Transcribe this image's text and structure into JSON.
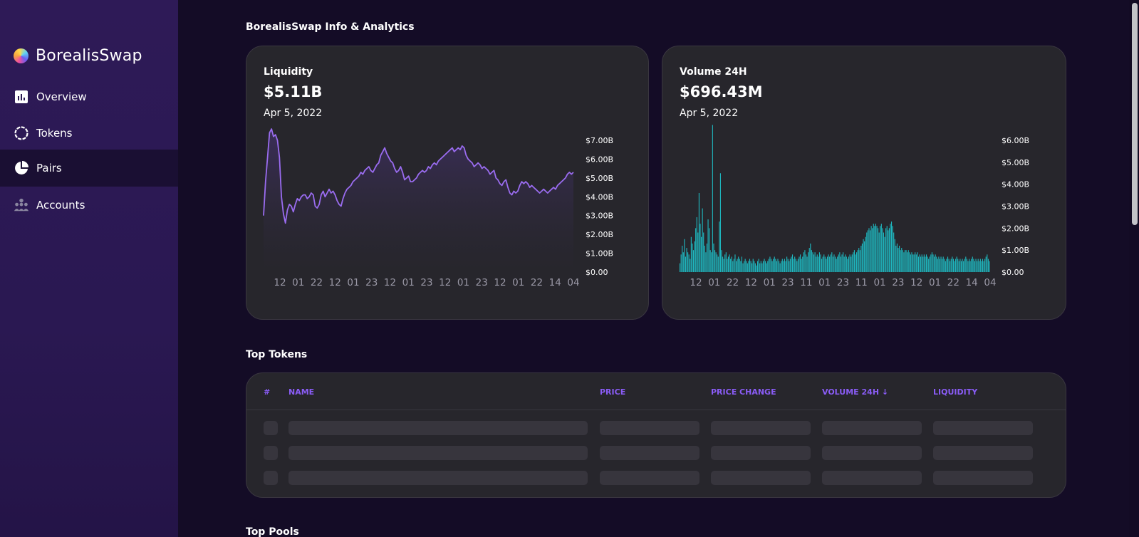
{
  "brand": {
    "name": "BorealisSwap"
  },
  "nav": [
    {
      "label": "Overview",
      "icon": "bar-chart-icon",
      "active": false
    },
    {
      "label": "Tokens",
      "icon": "token-ring-icon",
      "active": false
    },
    {
      "label": "Pairs",
      "icon": "pie-chart-icon",
      "active": true
    },
    {
      "label": "Accounts",
      "icon": "users-icon",
      "active": false
    }
  ],
  "page": {
    "title": "BorealisSwap Info & Analytics",
    "top_tokens_title": "Top Tokens",
    "top_pools_title": "Top Pools"
  },
  "liquidity_card": {
    "label": "Liquidity",
    "value": "$5.11B",
    "date": "Apr 5, 2022"
  },
  "volume_card": {
    "label": "Volume 24H",
    "value": "$696.43M",
    "date": "Apr 5, 2022"
  },
  "colors": {
    "accent_purple": "#8a5cf6",
    "liquidity_line": "#9a6cf0",
    "volume_bars": "#1fb8c0",
    "background": "#140c26",
    "card": "#27262c"
  },
  "chart_data": [
    {
      "type": "area",
      "title": "Liquidity",
      "x_tick_labels": [
        "12",
        "01",
        "22",
        "12",
        "01",
        "23",
        "12",
        "01",
        "23",
        "12",
        "01",
        "23",
        "12",
        "01",
        "22",
        "14",
        "04"
      ],
      "y_tick_labels": [
        "$0.00",
        "$1.00B",
        "$2.00B",
        "$3.00B",
        "$4.00B",
        "$5.00B",
        "$6.00B",
        "$7.00B"
      ],
      "ylim": [
        0,
        7.0
      ],
      "y_unit": "B",
      "series": [
        {
          "values": [
            3.0,
            4.8,
            6.1,
            7.4,
            7.6,
            7.2,
            7.3,
            7.0,
            6.1,
            4.0,
            3.1,
            2.6,
            3.3,
            3.6,
            3.5,
            3.2,
            3.6,
            3.9,
            3.8,
            4.0,
            4.1,
            4.1,
            3.9,
            4.0,
            4.2,
            4.1,
            3.5,
            3.4,
            3.6,
            4.1,
            4.3,
            4.0,
            4.2,
            4.4,
            4.2,
            4.3,
            4.1,
            3.8,
            3.6,
            3.5,
            3.9,
            4.2,
            4.4,
            4.5,
            4.6,
            4.8,
            4.9,
            5.0,
            5.1,
            5.3,
            5.2,
            5.4,
            5.5,
            5.6,
            5.4,
            5.3,
            5.5,
            5.7,
            5.8,
            6.2,
            6.4,
            6.6,
            6.3,
            6.1,
            5.9,
            5.8,
            5.5,
            5.3,
            5.4,
            5.6,
            5.3,
            4.9,
            5.0,
            5.1,
            4.8,
            4.8,
            4.9,
            5.0,
            5.2,
            5.3,
            5.4,
            5.3,
            5.4,
            5.6,
            5.5,
            5.7,
            5.8,
            5.7,
            5.9,
            6.0,
            6.1,
            6.2,
            6.3,
            6.4,
            6.5,
            6.6,
            6.4,
            6.5,
            6.6,
            6.5,
            6.7,
            6.6,
            6.2,
            6.0,
            5.9,
            5.8,
            5.6,
            5.7,
            5.8,
            5.7,
            5.5,
            5.6,
            5.5,
            5.4,
            5.2,
            5.3,
            5.4,
            5.0,
            4.9,
            4.7,
            4.6,
            4.8,
            4.9,
            4.5,
            4.2,
            4.1,
            4.3,
            4.2,
            4.3,
            4.6,
            4.8,
            4.7,
            4.8,
            4.7,
            4.5,
            4.6,
            4.5,
            4.4,
            4.3,
            4.2,
            4.3,
            4.4,
            4.3,
            4.2,
            4.3,
            4.4,
            4.5,
            4.4,
            4.6,
            4.7,
            4.8,
            4.9,
            5.0,
            5.2,
            5.3,
            5.2,
            5.3
          ]
        }
      ]
    },
    {
      "type": "bar",
      "title": "Volume 24H",
      "x_tick_labels": [
        "12",
        "01",
        "22",
        "12",
        "01",
        "23",
        "11",
        "01",
        "23",
        "11",
        "01",
        "23",
        "12",
        "01",
        "22",
        "14",
        "04"
      ],
      "y_tick_labels": [
        "$0.00",
        "$1.00B",
        "$2.00B",
        "$3.00B",
        "$4.00B",
        "$5.00B",
        "$6.00B"
      ],
      "ylim": [
        0,
        6.0
      ],
      "y_unit": "B",
      "series": [
        {
          "values": [
            0.4,
            0.8,
            1.2,
            0.9,
            1.5,
            0.7,
            1.1,
            0.9,
            0.8,
            0.6,
            1.6,
            1.3,
            1.0,
            1.4,
            2.0,
            2.5,
            1.8,
            3.6,
            2.2,
            1.6,
            2.9,
            1.8,
            1.2,
            0.9,
            1.3,
            2.4,
            2.0,
            1.0,
            0.9,
            6.7,
            1.3,
            1.0,
            0.9,
            0.8,
            0.7,
            2.3,
            4.5,
            1.0,
            0.7,
            0.6,
            0.8,
            0.9,
            0.6,
            0.7,
            0.8,
            0.6,
            0.7,
            0.5,
            0.6,
            0.8,
            0.5,
            0.6,
            0.7,
            0.6,
            0.5,
            0.7,
            0.4,
            0.5,
            0.6,
            0.5,
            0.4,
            0.5,
            0.6,
            0.5,
            0.4,
            0.6,
            0.5,
            0.4,
            0.3,
            0.5,
            0.6,
            0.4,
            0.5,
            0.4,
            0.5,
            0.6,
            0.5,
            0.4,
            0.5,
            0.6,
            0.7,
            0.6,
            0.5,
            0.6,
            0.7,
            0.6,
            0.5,
            0.6,
            0.5,
            0.4,
            0.5,
            0.6,
            0.5,
            0.6,
            0.5,
            0.7,
            0.6,
            0.5,
            0.6,
            0.7,
            0.8,
            0.6,
            0.7,
            0.6,
            0.5,
            0.6,
            0.7,
            0.8,
            0.6,
            0.7,
            0.9,
            1.0,
            0.8,
            0.7,
            0.9,
            1.1,
            1.3,
            1.0,
            0.9,
            0.8,
            0.9,
            0.7,
            0.8,
            0.7,
            0.9,
            0.8,
            0.6,
            0.7,
            0.8,
            0.7,
            0.6,
            0.7,
            0.8,
            0.7,
            0.8,
            0.9,
            0.7,
            0.8,
            0.7,
            0.6,
            0.7,
            0.8,
            0.9,
            0.7,
            0.8,
            0.9,
            0.7,
            0.8,
            0.7,
            0.6,
            0.7,
            0.8,
            0.7,
            0.8,
            0.9,
            1.0,
            0.8,
            0.9,
            1.0,
            1.1,
            1.0,
            1.2,
            1.3,
            1.5,
            1.4,
            1.6,
            1.8,
            1.9,
            2.0,
            1.9,
            2.1,
            2.0,
            2.2,
            2.1,
            2.2,
            2.1,
            2.0,
            1.8,
            2.1,
            2.2,
            2.0,
            1.8,
            1.6,
            2.0,
            2.1,
            1.9,
            2.0,
            2.2,
            2.3,
            2.1,
            1.8,
            1.5,
            1.2,
            1.3,
            1.1,
            1.2,
            1.0,
            1.1,
            1.0,
            0.9,
            1.0,
            1.0,
            0.9,
            1.0,
            0.9,
            0.8,
            0.9,
            0.8,
            0.8,
            0.9,
            0.8,
            0.9,
            0.7,
            0.8,
            0.7,
            0.8,
            0.7,
            0.8,
            0.7,
            0.8,
            0.7,
            0.6,
            0.7,
            0.8,
            0.9,
            0.8,
            0.7,
            0.8,
            0.7,
            0.6,
            0.7,
            0.6,
            0.7,
            0.6,
            0.7,
            0.6,
            0.5,
            0.6,
            0.7,
            0.6,
            0.5,
            0.6,
            0.7,
            0.6,
            0.5,
            0.6,
            0.7,
            0.6,
            0.5,
            0.6,
            0.5,
            0.6,
            0.5,
            0.6,
            0.7,
            0.6,
            0.5,
            0.6,
            0.5,
            0.6,
            0.7,
            0.6,
            0.5,
            0.6,
            0.5,
            0.6,
            0.5,
            0.6,
            0.5,
            0.6,
            0.5,
            0.6,
            0.7,
            0.8,
            0.6,
            0.5
          ]
        }
      ]
    }
  ],
  "top_tokens_table": {
    "columns": [
      "#",
      "NAME",
      "PRICE",
      "PRICE CHANGE",
      "VOLUME 24H ↓",
      "LIQUIDITY"
    ],
    "loading_rows": 3
  }
}
